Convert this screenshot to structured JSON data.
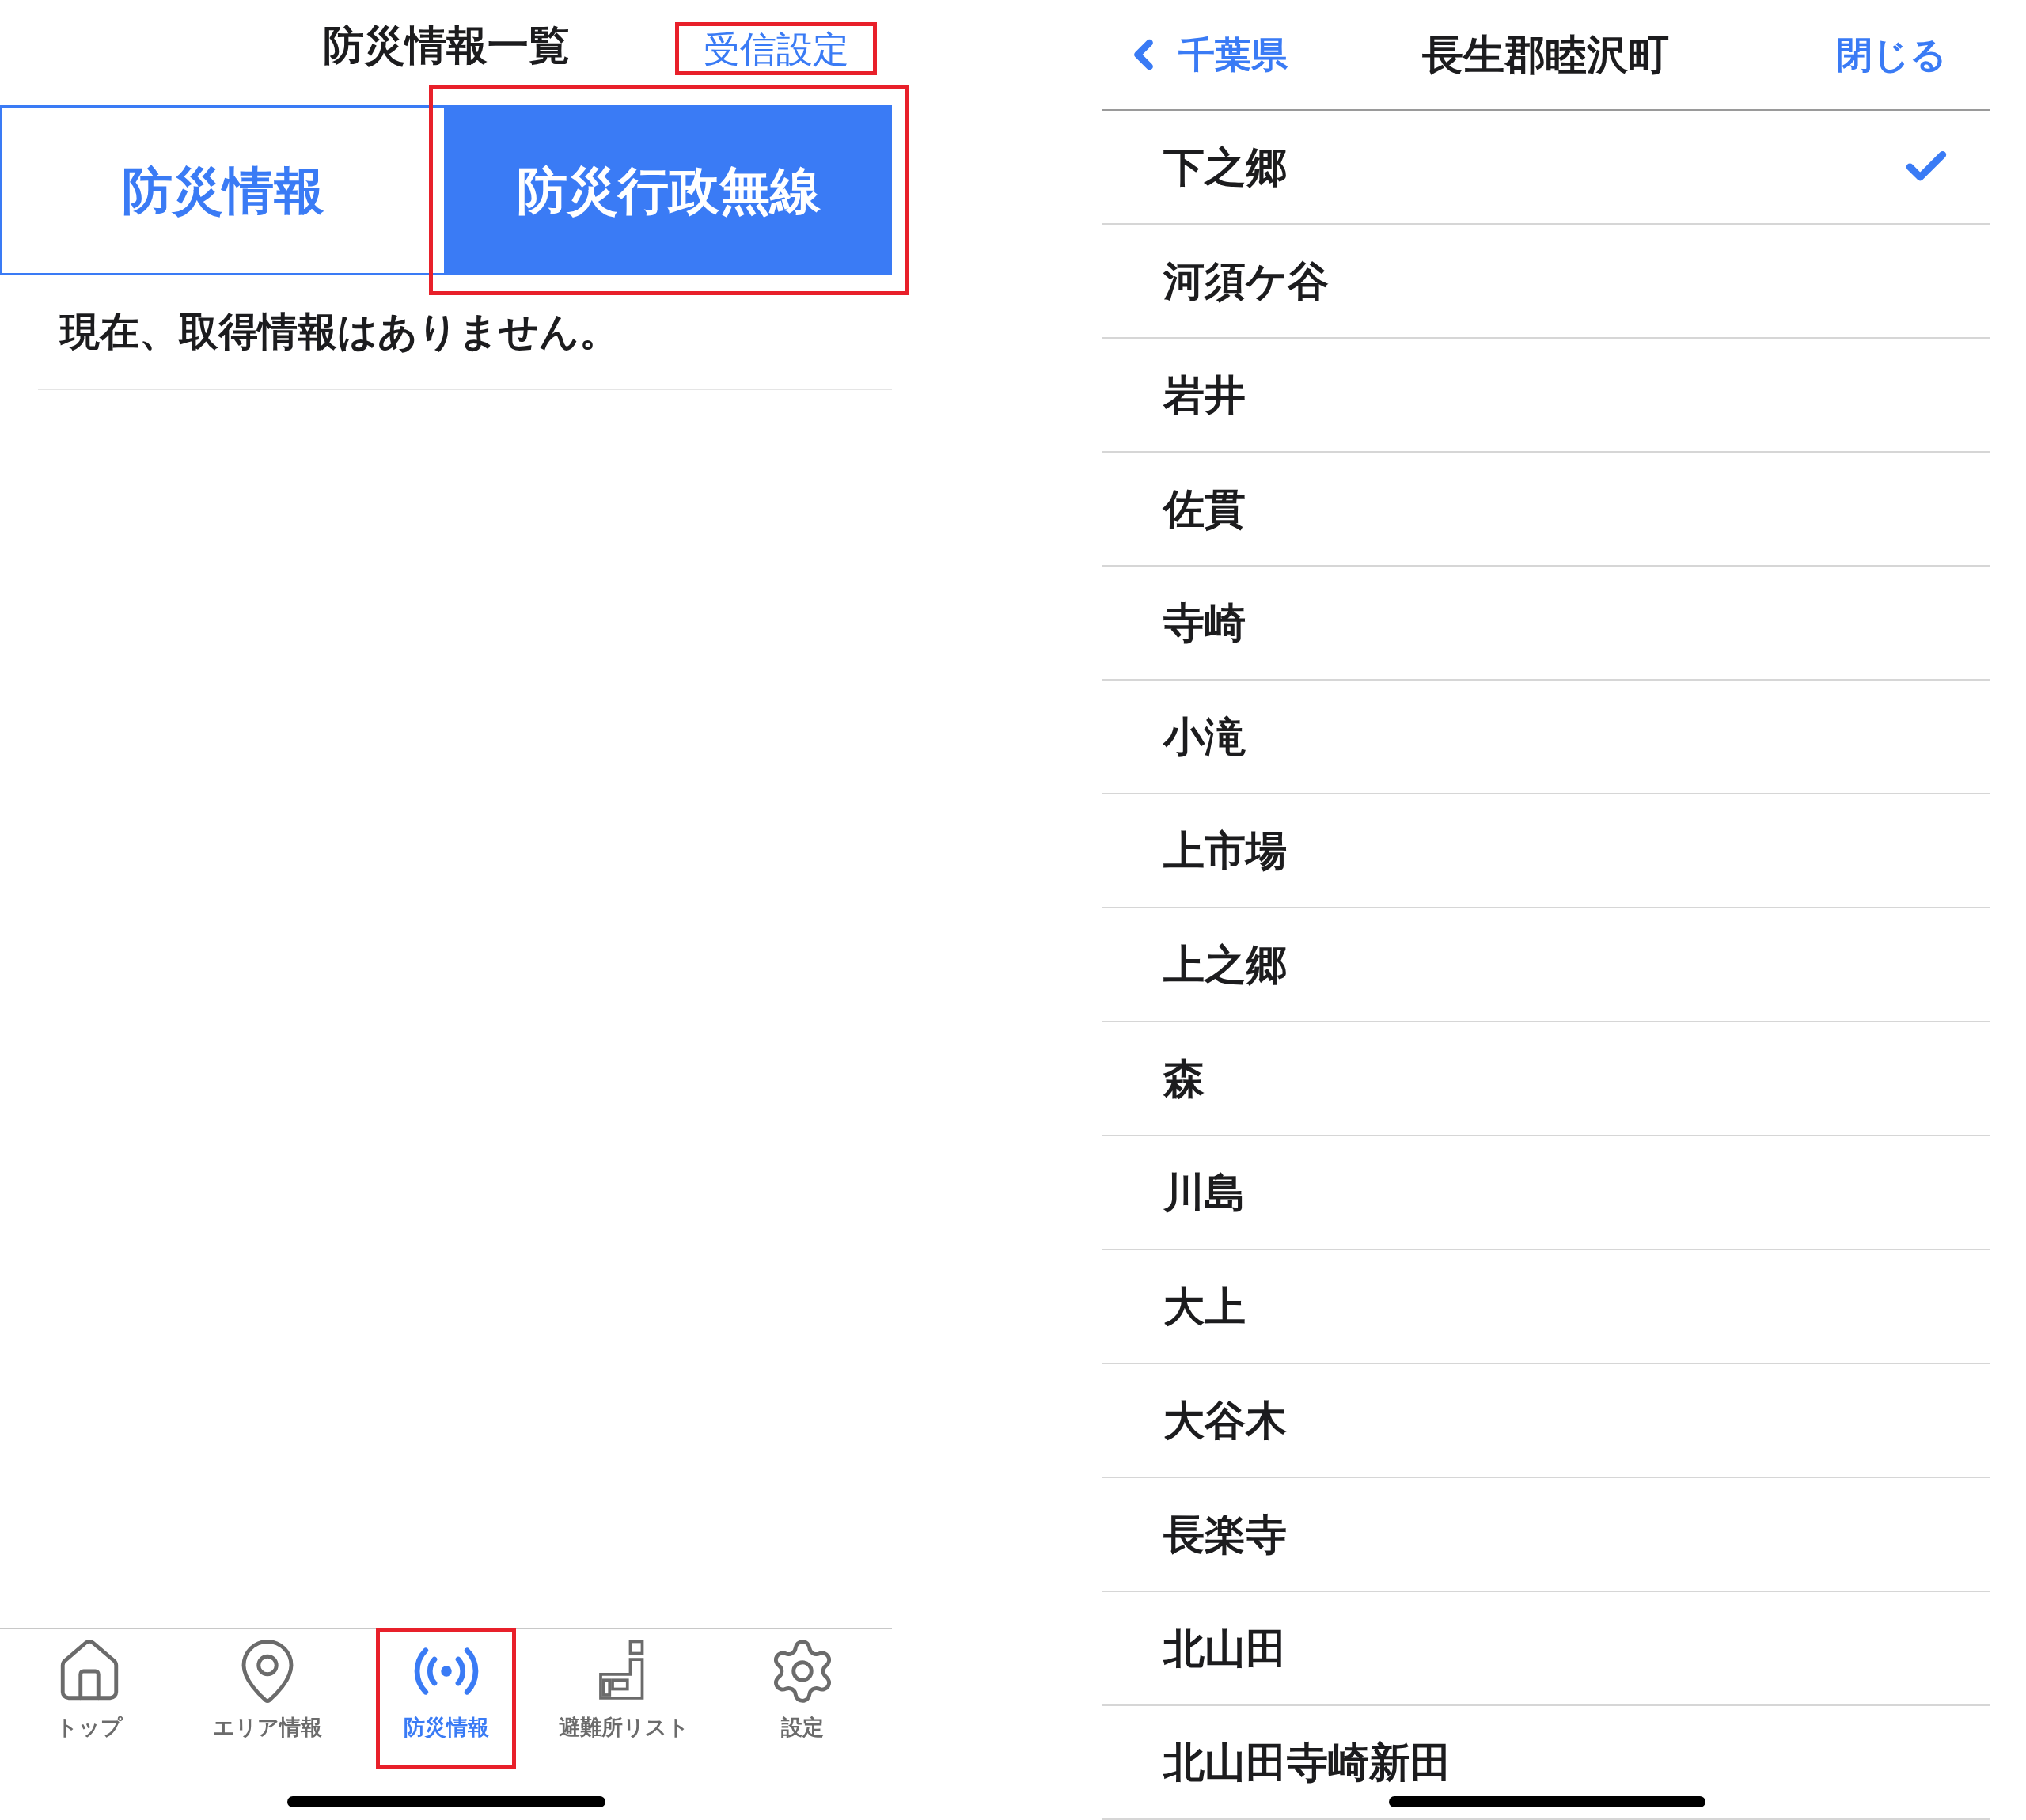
{
  "left_screen": {
    "title": "防災情報一覧",
    "settings_link": {
      "label": "受信設定",
      "highlighted": true
    },
    "segments": [
      {
        "label": "防災情報",
        "selected": false,
        "highlighted": false
      },
      {
        "label": "防災行政無線",
        "selected": true,
        "highlighted": true
      }
    ],
    "message": "現在、取得情報はありません。",
    "tab_bar": [
      {
        "kind": "home",
        "label": "トップ",
        "selected": false,
        "highlighted": false
      },
      {
        "kind": "pin",
        "label": "エリア情報",
        "selected": false,
        "highlighted": false
      },
      {
        "kind": "broadcast",
        "label": "防災情報",
        "selected": true,
        "highlighted": true
      },
      {
        "kind": "shelter",
        "label": "避難所リスト",
        "selected": false,
        "highlighted": false
      },
      {
        "kind": "gear",
        "label": "設定",
        "selected": false,
        "highlighted": false
      }
    ]
  },
  "right_screen": {
    "back_label": "千葉県",
    "title": "長生郡睦沢町",
    "close_label": "閉じる",
    "items": [
      {
        "label": "下之郷",
        "selected": true
      },
      {
        "label": "河須ケ谷",
        "selected": false
      },
      {
        "label": "岩井",
        "selected": false
      },
      {
        "label": "佐貫",
        "selected": false
      },
      {
        "label": "寺崎",
        "selected": false
      },
      {
        "label": "小滝",
        "selected": false
      },
      {
        "label": "上市場",
        "selected": false
      },
      {
        "label": "上之郷",
        "selected": false
      },
      {
        "label": "森",
        "selected": false
      },
      {
        "label": "川島",
        "selected": false
      },
      {
        "label": "大上",
        "selected": false
      },
      {
        "label": "大谷木",
        "selected": false
      },
      {
        "label": "長楽寺",
        "selected": false
      },
      {
        "label": "北山田",
        "selected": false
      },
      {
        "label": "北山田寺崎新田",
        "selected": false
      }
    ]
  }
}
